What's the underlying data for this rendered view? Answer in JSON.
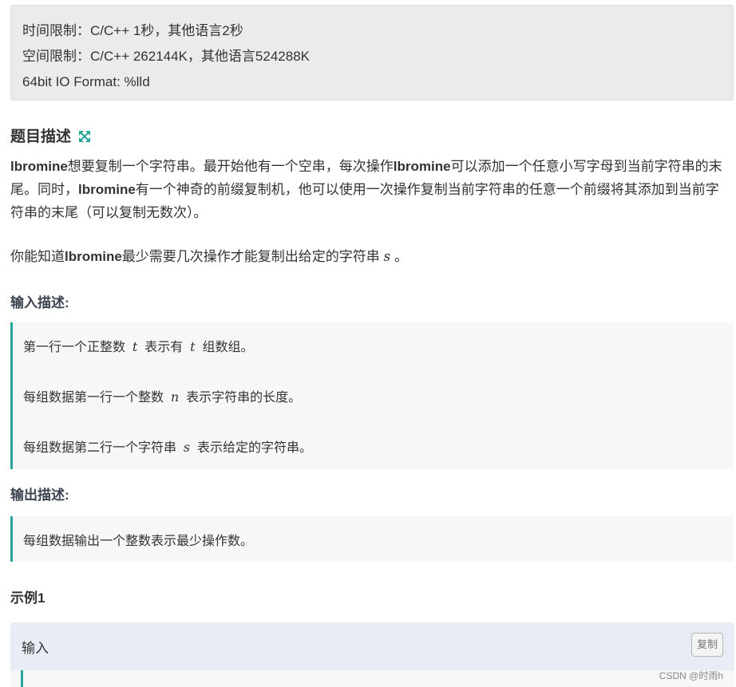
{
  "limits": {
    "time": "时间限制：C/C++ 1秒，其他语言2秒",
    "space": "空间限制：C/C++ 262144K，其他语言524288K",
    "io_format": "64bit IO Format: %lld"
  },
  "description": {
    "title": "题目描述",
    "p1_name1": "lbromine",
    "p1_text1": "想要复制一个字符串。最开始他有一个空串，每次操作",
    "p1_name2": "lbromine",
    "p1_text2": "可以添加一个任意小写字母到当前字符串的末尾。同时，",
    "p1_name3": "lbromine",
    "p1_text3": "有一个神奇的前缀复制机，他可以使用一次操作复制当前字符串的任意一个前缀将其添加到当前字符串的末尾（可以复制无数次）。",
    "p2_text1": "你能知道",
    "p2_name": "lbromine",
    "p2_text2": "最少需要几次操作才能复制出给定的字符串",
    "p2_var": "s",
    "p2_end": "。"
  },
  "input_desc": {
    "title": "输入描述:",
    "l1_a": "第一行一个正整数",
    "l1_var1": "t",
    "l1_b": "表示有",
    "l1_var2": "t",
    "l1_c": "组数组。",
    "l2_a": "每组数据第一行一个整数",
    "l2_var": "n",
    "l2_b": "表示字符串的长度。",
    "l3_a": "每组数据第二行一个字符串",
    "l3_var": "s",
    "l3_b": "表示给定的字符串。"
  },
  "output_desc": {
    "title": "输出描述:",
    "text": "每组数据输出一个整数表示最少操作数。"
  },
  "example": {
    "title": "示例1",
    "input_label": "输入",
    "copy_label": "复制"
  },
  "watermark": "CSDN @时雨h",
  "colors": {
    "accent": "#26a69a",
    "icon": "#26a69a"
  },
  "icons": {
    "expand": "expand-arrows-icon"
  }
}
